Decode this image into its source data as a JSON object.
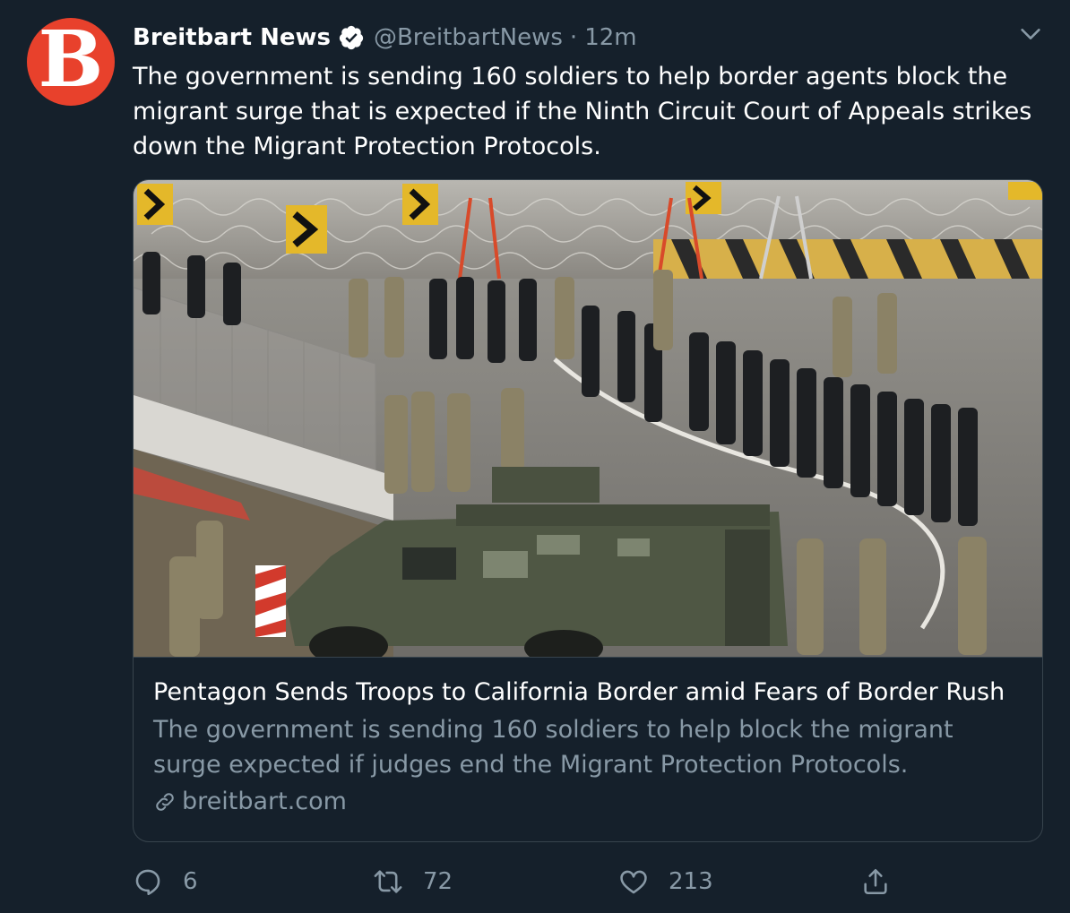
{
  "tweet": {
    "author": {
      "name": "Breitbart News",
      "handle": "@BreitbartNews",
      "avatar_letter": "B",
      "avatar_color": "#e8412c",
      "verified": true
    },
    "separator": "·",
    "time": "12m",
    "text": "The government is sending 160 soldiers to help border agents block the migrant surge that is expected if the Ninth Circuit Court of Appeals strikes down the Migrant Protection Protocols.",
    "card": {
      "title": "Pentagon Sends Troops to California Border amid Fears of Border Rush",
      "description": "The government is sending 160 soldiers to help block the migrant surge expected if judges end the Migrant Protection Protocols.",
      "domain": "breitbart.com"
    },
    "actions": {
      "reply_count": "6",
      "retweet_count": "72",
      "like_count": "213"
    }
  },
  "icons": {
    "verified": "verified-badge-icon",
    "menu": "chevron-down-icon",
    "link": "link-icon",
    "reply": "reply-icon",
    "retweet": "retweet-icon",
    "like": "heart-icon",
    "share": "share-icon"
  },
  "colors": {
    "background": "#15202b",
    "text_primary": "#ffffff",
    "text_secondary": "#8899a6",
    "border": "#38444d"
  }
}
